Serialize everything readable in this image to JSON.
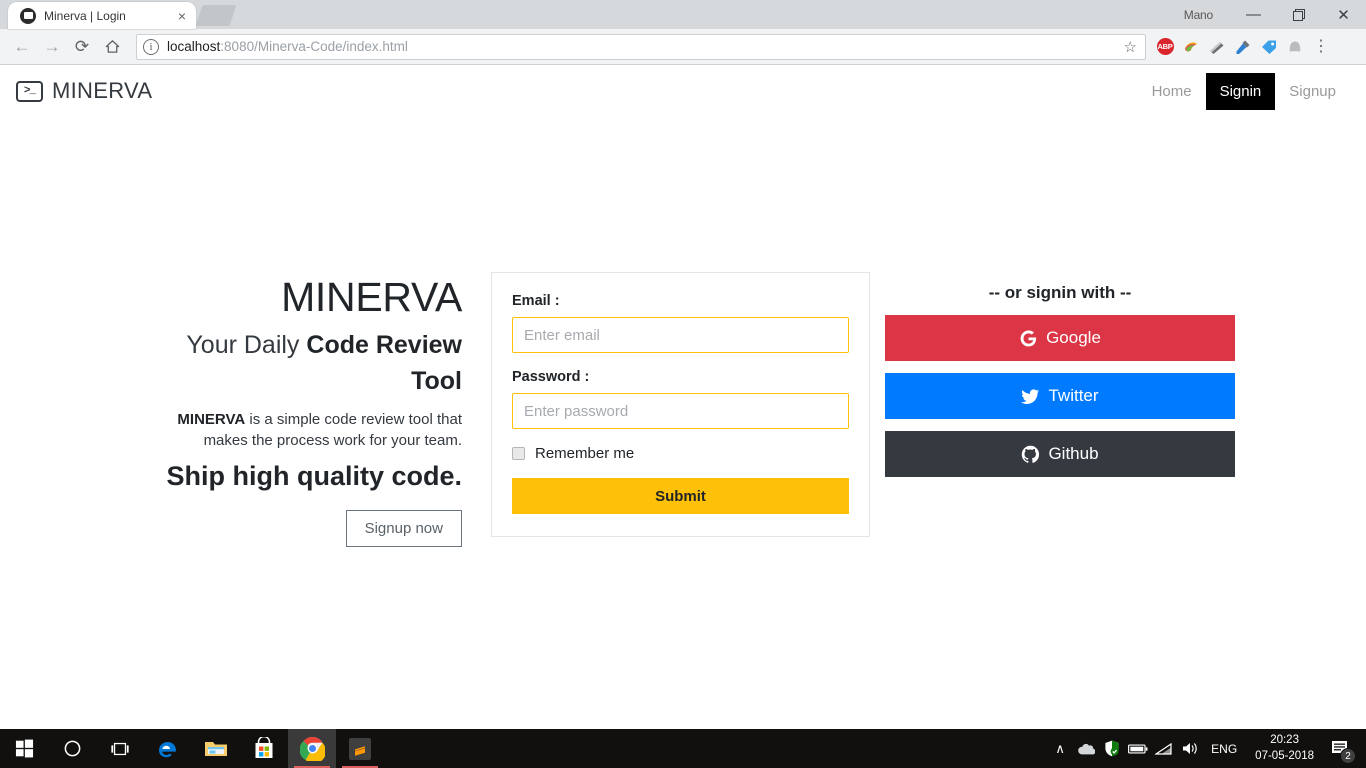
{
  "browser": {
    "tab": {
      "title": "Minerva | Login",
      "favicon": "terminal-favicon",
      "close": "×"
    },
    "profile_name": "Mano",
    "window_controls": {
      "minimize": "—",
      "maximize": "❐",
      "close": "✕"
    },
    "nav": {
      "back": "←",
      "forward": "→",
      "reload": "⟳",
      "home": "⌂"
    },
    "omnibox": {
      "info_icon": "ⓘ",
      "url_host": "localhost",
      "url_path": ":8080/Minerva-Code/index.html",
      "bookmark_icon": "☆"
    },
    "extensions": [
      {
        "name": "adblock-plus-icon",
        "label": "ABP"
      },
      {
        "name": "colorzilla-icon",
        "label": "◕"
      },
      {
        "name": "ruler-icon",
        "label": "◢"
      },
      {
        "name": "eyedropper-icon",
        "label": "✐"
      },
      {
        "name": "tag-icon",
        "label": "◇"
      },
      {
        "name": "ghost-icon",
        "label": "⬤"
      }
    ],
    "menu_icon": "⋮"
  },
  "site": {
    "brand": {
      "icon_text": ">_",
      "name": "MINERVA"
    },
    "nav_links": [
      {
        "label": "Home",
        "active": false
      },
      {
        "label": "Signin",
        "active": true
      },
      {
        "label": "Signup",
        "active": false
      }
    ],
    "hero": {
      "title": "MINERVA",
      "subtitle_light": "Your Daily ",
      "subtitle_bold": "Code Review Tool",
      "body_bold": "MINERVA",
      "body_rest": " is a simple code review tool that makes the process work for your team.",
      "tagline": "Ship high quality code.",
      "cta_label": "Signup now"
    },
    "form": {
      "email_label": "Email :",
      "email_placeholder": "Enter email",
      "email_value": "",
      "password_label": "Password :",
      "password_placeholder": "Enter password",
      "password_value": "",
      "remember_label": "Remember me",
      "remember_checked": false,
      "submit_label": "Submit"
    },
    "social": {
      "title": "-- or signin with --",
      "buttons": [
        {
          "label": "Google",
          "icon": "google-icon",
          "color": "#dc3545"
        },
        {
          "label": "Twitter",
          "icon": "twitter-icon",
          "color": "#007bff"
        },
        {
          "label": "Github",
          "icon": "github-icon",
          "color": "#343a40"
        }
      ]
    },
    "colors": {
      "accent": "#ffc107",
      "dark": "#343a40",
      "muted": "#9a9a9a"
    }
  },
  "taskbar": {
    "items": [
      {
        "name": "start-button",
        "glyph": "start"
      },
      {
        "name": "cortana-button",
        "glyph": "circle"
      },
      {
        "name": "task-view-button",
        "glyph": "taskview"
      },
      {
        "name": "edge-icon",
        "glyph": "edge"
      },
      {
        "name": "file-explorer-icon",
        "glyph": "folder"
      },
      {
        "name": "microsoft-store-icon",
        "glyph": "store"
      },
      {
        "name": "chrome-icon",
        "glyph": "chrome"
      },
      {
        "name": "sublime-text-icon",
        "glyph": "sublime"
      }
    ],
    "tray": {
      "chevron": "∧",
      "onedrive": "☁",
      "defender": "⛨",
      "battery": "▭",
      "wifi": "◠",
      "volume": "◂))",
      "language": "ENG",
      "time": "20:23",
      "date": "07-05-2018",
      "notifications_count": "2"
    }
  }
}
